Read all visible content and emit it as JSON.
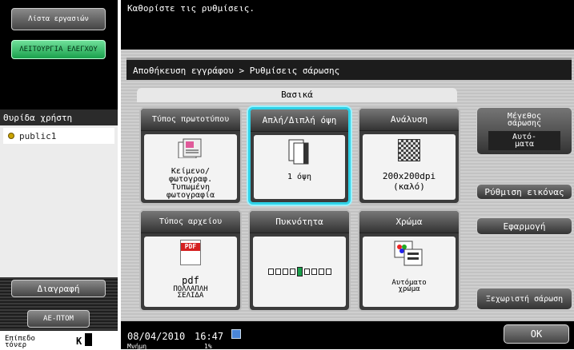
{
  "left": {
    "job_list": "Λίστα εργασιών",
    "check_function": "ΛΕΙΤΟΥΡΓΙΑ ΕΛΕΓΧΟΥ",
    "mailbox_title": "Θυρίδα χρήστη",
    "mailbox_item": "public1",
    "delete": "Διαγραφή",
    "zoom": "ΑΕ-ΠΤΟΜ",
    "toner_label": "Επίπεδο τόνερ",
    "toner_value": "K"
  },
  "header": {
    "message": "Καθορίστε τις ρυθμίσεις."
  },
  "breadcrumb": "Αποθήκευση εγγράφου > Ρυθμίσεις σάρωσης",
  "tab": "Βασικά",
  "tiles": [
    {
      "title": "Τύπος πρωτοτύπου",
      "value": "Κείμενο/ φωτογραφ. Τυπωμένη φωτογραφία"
    },
    {
      "title": "Απλή/Διπλή όψη",
      "value": "1 όψη"
    },
    {
      "title": "Ανάλυση",
      "value": "200x200dpi (καλό)"
    },
    {
      "title": "Τύπος αρχείου",
      "value": "PDF",
      "value2": "pdf",
      "value3": "ΠΟΛΛΑΠΛΗ ΣΕΛΙΔΑ"
    },
    {
      "title": "Πυκνότητα",
      "density_level": 5,
      "density_steps": 9
    },
    {
      "title": "Χρώμα",
      "value": "Αυτόματο χρώμα"
    }
  ],
  "right": {
    "scan_size": "Μέγεθος σάρωσης",
    "scan_size_value": "Αυτό- ματα",
    "image_adjust": "Ρύθμιση εικόνας",
    "application": "Εφαρμογή",
    "separate_scan": "Ξεχωριστή σάρωση"
  },
  "footer": {
    "date": "08/04/2010",
    "time": "16:47",
    "memory": "Μνήμη",
    "memory_value": "1%",
    "ok": "OK"
  },
  "colors": {
    "selected_border": "#2fd2e8",
    "green_button": "#2fc46a"
  }
}
